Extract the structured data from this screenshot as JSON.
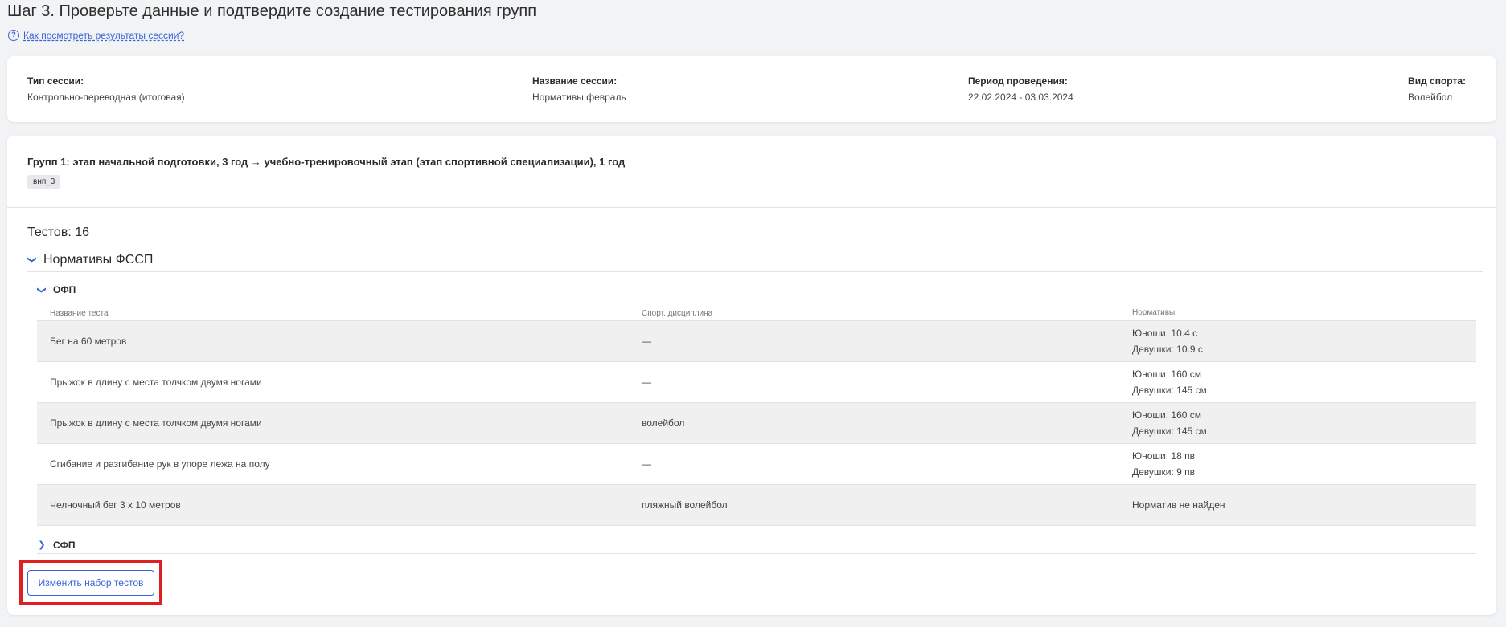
{
  "page": {
    "title": "Шаг 3. Проверьте данные и подтвердите создание тестирования групп",
    "help_link": "Как посмотреть результаты сессии?",
    "help_icon": "?"
  },
  "session_info": {
    "type_label": "Тип сессии:",
    "type_value": "Контрольно-переводная (итоговая)",
    "name_label": "Название сессии:",
    "name_value": "Нормативы февраль",
    "period_label": "Период проведения:",
    "period_value": "22.02.2024 - 03.03.2024",
    "sport_label": "Вид спорта:",
    "sport_value": "Волейбол"
  },
  "group": {
    "title": "Групп 1: этап начальной подготовки, 3 год → учебно-тренировочный этап (этап спортивной специализации), 1 год",
    "tag": "внп_3"
  },
  "tests": {
    "count_label": "Тестов: 16",
    "section_title": "Нормативы ФССП",
    "ofp_title": "ОФП",
    "sfp_title": "СФП",
    "columns": [
      "Название теста",
      "Спорт. дисциплина",
      "Нормативы"
    ],
    "rows": [
      {
        "name": "Бег на 60 метров",
        "discipline": "—",
        "norm1": "Юноши: 10.4 с",
        "norm2": "Девушки: 10.9 с"
      },
      {
        "name": "Прыжок в длину с места толчком двумя ногами",
        "discipline": "—",
        "norm1": "Юноши: 160 см",
        "norm2": "Девушки: 145 см"
      },
      {
        "name": "Прыжок в длину с места толчком двумя ногами",
        "discipline": "волейбол",
        "norm1": "Юноши: 160 см",
        "norm2": "Девушки: 145 см"
      },
      {
        "name": "Сгибание и разгибание рук в упоре лежа на полу",
        "discipline": "—",
        "norm1": "Юноши: 18 пв",
        "norm2": "Девушки: 9 пв"
      },
      {
        "name": "Челночный бег 3 х 10 метров",
        "discipline": "пляжный волейбол",
        "norm1": "Норматив не найден",
        "norm2": ""
      }
    ],
    "edit_button": "Изменить набор тестов"
  },
  "colors": {
    "accent": "#3a63d8",
    "highlight": "#e02020",
    "background": "#f2f3f5"
  }
}
